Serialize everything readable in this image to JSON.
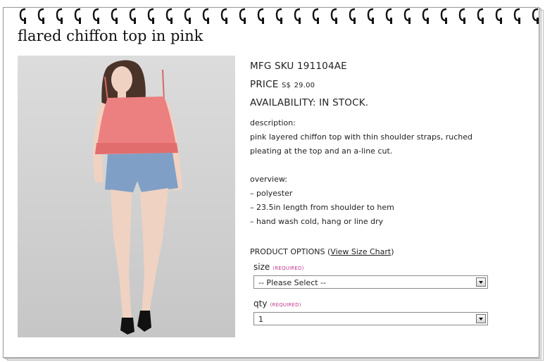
{
  "product": {
    "title": "flared chiffon top in pink",
    "mfg_sku": "MFG SKU 191104AE",
    "price_label": "PRICE",
    "price_currency": "S$",
    "price_value": "29.00",
    "availability": "AVAILABILITY: IN STOCK.",
    "description_heading": "description:",
    "description_line1": "pink layered chiffon top with thin shoulder straps, ruched",
    "description_line2": "pleating at the top and an a-line cut.",
    "overview_heading": "overview:",
    "overview": [
      "–   polyester",
      "–   23.5in length from shoulder to hem",
      "–   hand wash cold, hang or line dry"
    ],
    "image_alt": "model wearing pink chiffon top and denim shorts"
  },
  "options": {
    "heading": "PRODUCT OPTIONS",
    "size_chart_open": "(",
    "size_chart_link": "View Size Chart",
    "size_chart_close": ")",
    "size_label": "size",
    "size_required": "(REQUIRED)",
    "size_selected": "-- Please Select --",
    "qty_label": "qty",
    "qty_required": "(REQUIRED)",
    "qty_selected": "1"
  },
  "colors": {
    "top": "#ec7f7f",
    "denim": "#7f9fc6",
    "skin": "#efd2c2",
    "hair": "#4a3328",
    "required": "#c0398a"
  }
}
